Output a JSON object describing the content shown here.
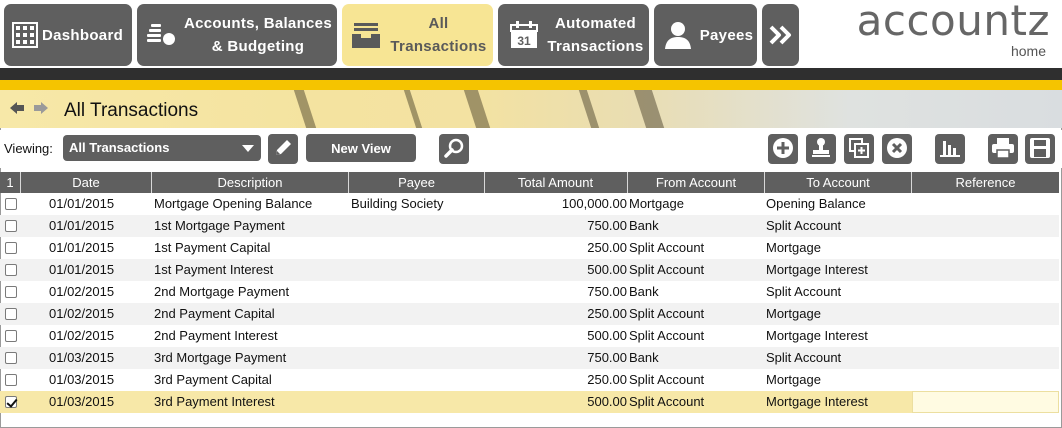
{
  "nav": {
    "dashboard": "Dashboard",
    "accounts_line1": "Accounts, Balances",
    "accounts_line2": "& Budgeting",
    "all_line1": "All",
    "all_line2": "Transactions",
    "auto_line1": "Automated",
    "auto_line2": "Transactions",
    "calendar_day": "31",
    "payees": "Payees",
    "more_icon": "double-chevron-right-icon"
  },
  "brand": {
    "logo": "accountz",
    "sub": "home"
  },
  "page": {
    "title": "All Transactions"
  },
  "toolbar": {
    "viewing_label": "Viewing:",
    "view_selected": "All Transactions",
    "new_view_label": "New View"
  },
  "table": {
    "columns": [
      "1",
      "Date",
      "Description",
      "Payee",
      "Total Amount",
      "From Account",
      "To Account",
      "Reference"
    ],
    "rows": [
      {
        "checked": false,
        "date": "01/01/2015",
        "description": "Mortgage Opening Balance",
        "payee": "Building Society",
        "amount": "100,000.00",
        "from": "Mortgage",
        "to": "Opening Balance",
        "reference": ""
      },
      {
        "checked": false,
        "date": "01/01/2015",
        "description": "1st Mortgage Payment",
        "payee": "",
        "amount": "750.00",
        "from": "Bank",
        "to": "Split Account",
        "reference": ""
      },
      {
        "checked": false,
        "date": "01/01/2015",
        "description": "1st Payment Capital",
        "payee": "",
        "amount": "250.00",
        "from": "Split Account",
        "to": "Mortgage",
        "reference": ""
      },
      {
        "checked": false,
        "date": "01/01/2015",
        "description": "1st Payment Interest",
        "payee": "",
        "amount": "500.00",
        "from": "Split Account",
        "to": "Mortgage Interest",
        "reference": ""
      },
      {
        "checked": false,
        "date": "01/02/2015",
        "description": "2nd Mortgage Payment",
        "payee": "",
        "amount": "750.00",
        "from": "Bank",
        "to": "Split Account",
        "reference": ""
      },
      {
        "checked": false,
        "date": "01/02/2015",
        "description": "2nd Payment Capital",
        "payee": "",
        "amount": "250.00",
        "from": "Split Account",
        "to": "Mortgage",
        "reference": ""
      },
      {
        "checked": false,
        "date": "01/02/2015",
        "description": "2nd Payment Interest",
        "payee": "",
        "amount": "500.00",
        "from": "Split Account",
        "to": "Mortgage Interest",
        "reference": ""
      },
      {
        "checked": false,
        "date": "01/03/2015",
        "description": "3rd Mortgage Payment",
        "payee": "",
        "amount": "750.00",
        "from": "Bank",
        "to": "Split Account",
        "reference": ""
      },
      {
        "checked": false,
        "date": "01/03/2015",
        "description": "3rd Payment Capital",
        "payee": "",
        "amount": "250.00",
        "from": "Split Account",
        "to": "Mortgage",
        "reference": ""
      },
      {
        "checked": true,
        "date": "01/03/2015",
        "description": "3rd Payment Interest",
        "payee": "",
        "amount": "500.00",
        "from": "Split Account",
        "to": "Mortgage Interest",
        "reference": ""
      }
    ]
  },
  "colors": {
    "button_gray": "#5f5f5f",
    "active_tab": "#f7e594",
    "accent_yellow": "#f5c400",
    "selected_row": "#f7e8a8"
  }
}
